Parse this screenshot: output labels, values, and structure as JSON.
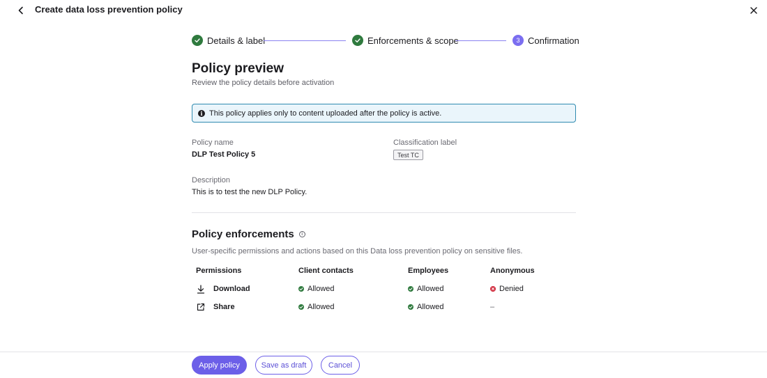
{
  "header": {
    "title": "Create data loss prevention policy"
  },
  "stepper": {
    "steps": [
      {
        "label": "Details & label",
        "state": "done"
      },
      {
        "label": "Enforcements & scope",
        "state": "done"
      },
      {
        "label": "Confirmation",
        "state": "current",
        "number": "3"
      }
    ]
  },
  "page": {
    "title": "Policy preview",
    "subtitle": "Review the policy details before activation"
  },
  "banner": {
    "icon": "info-icon",
    "text": "This policy applies only to content uploaded after the policy is active."
  },
  "details": {
    "policy_name_label": "Policy name",
    "policy_name_value": "DLP Test Policy 5",
    "classification_label": "Classification label",
    "classification_value": "Test TC",
    "description_label": "Description",
    "description_value": "This is to test the new DLP Policy."
  },
  "enforcements": {
    "title": "Policy enforcements",
    "description": "User-specific permissions and actions based on this Data loss prevention policy on sensitive files.",
    "columns": [
      "Permissions",
      "Client contacts",
      "Employees",
      "Anonymous"
    ],
    "rows": [
      {
        "permission": "Download",
        "icon": "download-icon",
        "client_contacts": "Allowed",
        "employees": "Allowed",
        "anonymous": "Denied"
      },
      {
        "permission": "Share",
        "icon": "share-icon",
        "client_contacts": "Allowed",
        "employees": "Allowed",
        "anonymous": "–"
      }
    ]
  },
  "footer": {
    "apply_label": "Apply policy",
    "draft_label": "Save as draft",
    "cancel_label": "Cancel"
  },
  "colors": {
    "accent": "#6c5fe8",
    "success": "#2f7a3e",
    "danger": "#d0283a",
    "info_border": "#2e8ab0",
    "info_bg": "#eaf5fb"
  }
}
